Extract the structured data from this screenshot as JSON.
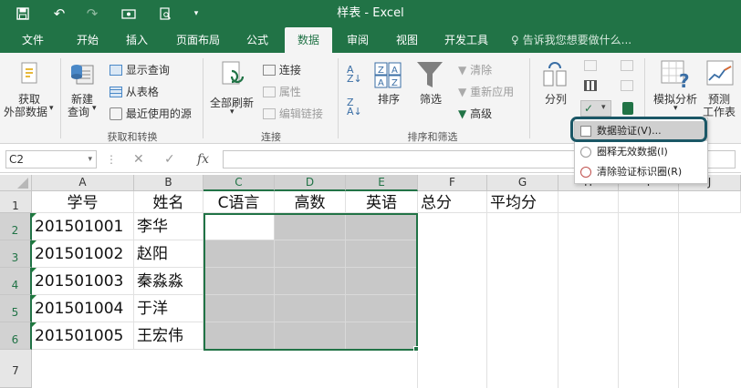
{
  "window": {
    "title": "样表 - Excel",
    "quick_access": [
      "save-icon",
      "undo-icon",
      "redo-icon",
      "touch-mode-icon",
      "print-preview-icon",
      "customize-icon"
    ]
  },
  "tabs": [
    "文件",
    "开始",
    "插入",
    "页面布局",
    "公式",
    "数据",
    "审阅",
    "视图",
    "开发工具"
  ],
  "active_tab": "数据",
  "tell_me": "告诉我您想要做什么...",
  "ribbon": {
    "get_external": "获取",
    "get_external2": "外部数据",
    "new_query": "新建",
    "new_query2": "查询",
    "show_queries": "显示查询",
    "from_table": "从表格",
    "recent_sources": "最近使用的源",
    "group_get_transform": "获取和转换",
    "refresh_all": "全部刷新",
    "connections": "连接",
    "properties": "属性",
    "edit_links": "编辑链接",
    "group_connections": "连接",
    "sort": "排序",
    "filter": "筛选",
    "clear": "清除",
    "reapply": "重新应用",
    "advanced": "高级",
    "group_sort_filter": "排序和筛选",
    "text_to_columns": "分列",
    "what_if": "模拟分析",
    "forecast": "预测",
    "forecast2": "工作表"
  },
  "dropdown": {
    "items": [
      "数据验证(V)...",
      "圈释无效数据(I)",
      "清除验证标识圈(R)"
    ],
    "highlighted_index": 0
  },
  "formula_bar": {
    "name_box": "C2",
    "fx": "fx",
    "content": ""
  },
  "sheet": {
    "columns": [
      "A",
      "B",
      "C",
      "D",
      "E",
      "F",
      "G",
      "H",
      "I",
      "J"
    ],
    "selected_columns": [
      "C",
      "D",
      "E"
    ],
    "rows": [
      "1",
      "2",
      "3",
      "4",
      "5",
      "6",
      "7"
    ],
    "selected_rows": [
      "2",
      "3",
      "4",
      "5",
      "6"
    ],
    "headers": [
      "学号",
      "姓名",
      "C语言",
      "高数",
      "英语",
      "总分",
      "平均分"
    ],
    "students": [
      {
        "id": "201501001",
        "name": "李华"
      },
      {
        "id": "201501002",
        "name": "赵阳"
      },
      {
        "id": "201501003",
        "name": "秦淼淼"
      },
      {
        "id": "201501004",
        "name": "于洋"
      },
      {
        "id": "201501005",
        "name": "王宏伟"
      }
    ],
    "active_cell": "C2",
    "selection": "C2:E6"
  },
  "colors": {
    "accent": "#217346",
    "selection_fill": "#c8c8c8",
    "callout_border": "#1b5766"
  }
}
